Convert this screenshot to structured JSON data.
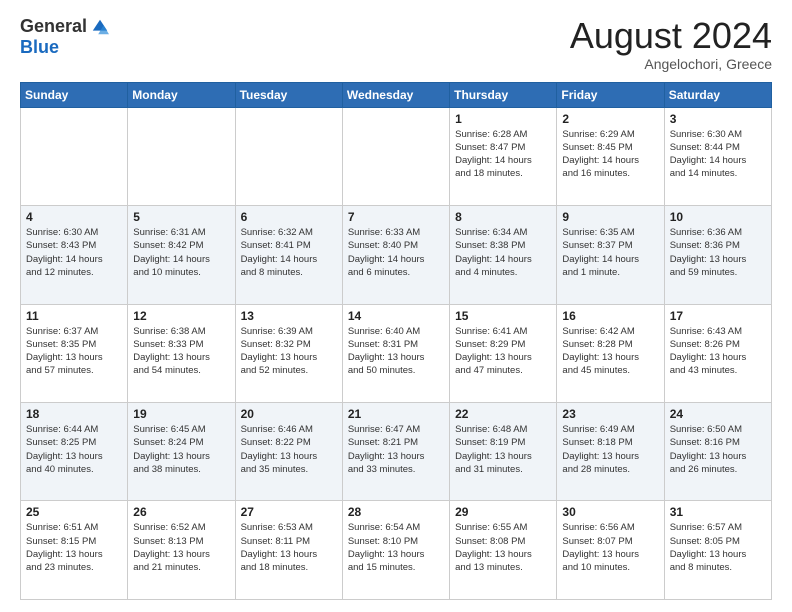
{
  "header": {
    "logo_general": "General",
    "logo_blue": "Blue",
    "month_year": "August 2024",
    "location": "Angelochori, Greece"
  },
  "days_of_week": [
    "Sunday",
    "Monday",
    "Tuesday",
    "Wednesday",
    "Thursday",
    "Friday",
    "Saturday"
  ],
  "weeks": [
    [
      {
        "day": "",
        "info": ""
      },
      {
        "day": "",
        "info": ""
      },
      {
        "day": "",
        "info": ""
      },
      {
        "day": "",
        "info": ""
      },
      {
        "day": "1",
        "info": "Sunrise: 6:28 AM\nSunset: 8:47 PM\nDaylight: 14 hours\nand 18 minutes."
      },
      {
        "day": "2",
        "info": "Sunrise: 6:29 AM\nSunset: 8:45 PM\nDaylight: 14 hours\nand 16 minutes."
      },
      {
        "day": "3",
        "info": "Sunrise: 6:30 AM\nSunset: 8:44 PM\nDaylight: 14 hours\nand 14 minutes."
      }
    ],
    [
      {
        "day": "4",
        "info": "Sunrise: 6:30 AM\nSunset: 8:43 PM\nDaylight: 14 hours\nand 12 minutes."
      },
      {
        "day": "5",
        "info": "Sunrise: 6:31 AM\nSunset: 8:42 PM\nDaylight: 14 hours\nand 10 minutes."
      },
      {
        "day": "6",
        "info": "Sunrise: 6:32 AM\nSunset: 8:41 PM\nDaylight: 14 hours\nand 8 minutes."
      },
      {
        "day": "7",
        "info": "Sunrise: 6:33 AM\nSunset: 8:40 PM\nDaylight: 14 hours\nand 6 minutes."
      },
      {
        "day": "8",
        "info": "Sunrise: 6:34 AM\nSunset: 8:38 PM\nDaylight: 14 hours\nand 4 minutes."
      },
      {
        "day": "9",
        "info": "Sunrise: 6:35 AM\nSunset: 8:37 PM\nDaylight: 14 hours\nand 1 minute."
      },
      {
        "day": "10",
        "info": "Sunrise: 6:36 AM\nSunset: 8:36 PM\nDaylight: 13 hours\nand 59 minutes."
      }
    ],
    [
      {
        "day": "11",
        "info": "Sunrise: 6:37 AM\nSunset: 8:35 PM\nDaylight: 13 hours\nand 57 minutes."
      },
      {
        "day": "12",
        "info": "Sunrise: 6:38 AM\nSunset: 8:33 PM\nDaylight: 13 hours\nand 54 minutes."
      },
      {
        "day": "13",
        "info": "Sunrise: 6:39 AM\nSunset: 8:32 PM\nDaylight: 13 hours\nand 52 minutes."
      },
      {
        "day": "14",
        "info": "Sunrise: 6:40 AM\nSunset: 8:31 PM\nDaylight: 13 hours\nand 50 minutes."
      },
      {
        "day": "15",
        "info": "Sunrise: 6:41 AM\nSunset: 8:29 PM\nDaylight: 13 hours\nand 47 minutes."
      },
      {
        "day": "16",
        "info": "Sunrise: 6:42 AM\nSunset: 8:28 PM\nDaylight: 13 hours\nand 45 minutes."
      },
      {
        "day": "17",
        "info": "Sunrise: 6:43 AM\nSunset: 8:26 PM\nDaylight: 13 hours\nand 43 minutes."
      }
    ],
    [
      {
        "day": "18",
        "info": "Sunrise: 6:44 AM\nSunset: 8:25 PM\nDaylight: 13 hours\nand 40 minutes."
      },
      {
        "day": "19",
        "info": "Sunrise: 6:45 AM\nSunset: 8:24 PM\nDaylight: 13 hours\nand 38 minutes."
      },
      {
        "day": "20",
        "info": "Sunrise: 6:46 AM\nSunset: 8:22 PM\nDaylight: 13 hours\nand 35 minutes."
      },
      {
        "day": "21",
        "info": "Sunrise: 6:47 AM\nSunset: 8:21 PM\nDaylight: 13 hours\nand 33 minutes."
      },
      {
        "day": "22",
        "info": "Sunrise: 6:48 AM\nSunset: 8:19 PM\nDaylight: 13 hours\nand 31 minutes."
      },
      {
        "day": "23",
        "info": "Sunrise: 6:49 AM\nSunset: 8:18 PM\nDaylight: 13 hours\nand 28 minutes."
      },
      {
        "day": "24",
        "info": "Sunrise: 6:50 AM\nSunset: 8:16 PM\nDaylight: 13 hours\nand 26 minutes."
      }
    ],
    [
      {
        "day": "25",
        "info": "Sunrise: 6:51 AM\nSunset: 8:15 PM\nDaylight: 13 hours\nand 23 minutes."
      },
      {
        "day": "26",
        "info": "Sunrise: 6:52 AM\nSunset: 8:13 PM\nDaylight: 13 hours\nand 21 minutes."
      },
      {
        "day": "27",
        "info": "Sunrise: 6:53 AM\nSunset: 8:11 PM\nDaylight: 13 hours\nand 18 minutes."
      },
      {
        "day": "28",
        "info": "Sunrise: 6:54 AM\nSunset: 8:10 PM\nDaylight: 13 hours\nand 15 minutes."
      },
      {
        "day": "29",
        "info": "Sunrise: 6:55 AM\nSunset: 8:08 PM\nDaylight: 13 hours\nand 13 minutes."
      },
      {
        "day": "30",
        "info": "Sunrise: 6:56 AM\nSunset: 8:07 PM\nDaylight: 13 hours\nand 10 minutes."
      },
      {
        "day": "31",
        "info": "Sunrise: 6:57 AM\nSunset: 8:05 PM\nDaylight: 13 hours\nand 8 minutes."
      }
    ]
  ]
}
